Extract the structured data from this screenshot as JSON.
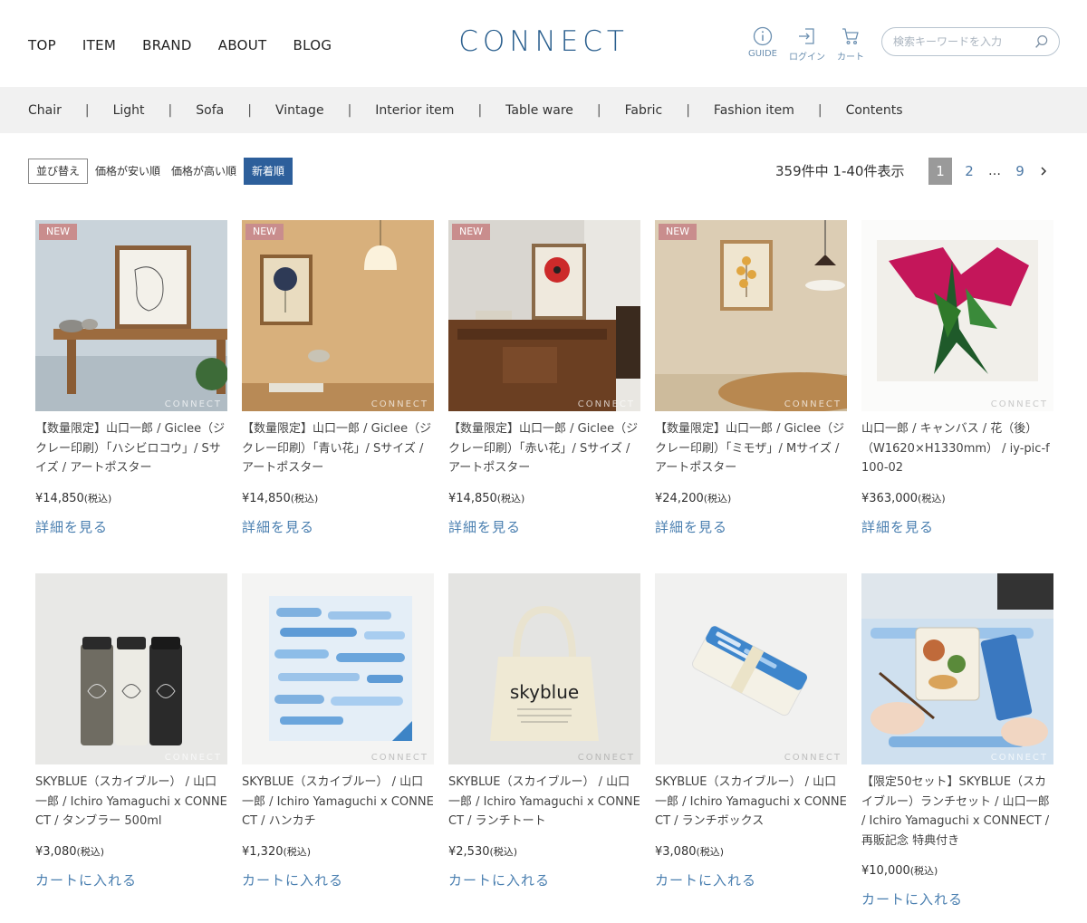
{
  "nav": [
    "TOP",
    "ITEM",
    "BRAND",
    "ABOUT",
    "BLOG"
  ],
  "logo": "CONNECT",
  "util": {
    "guide": "GUIDE",
    "login": "ログイン",
    "cart": "カート"
  },
  "search": {
    "placeholder": "検索キーワードを入力"
  },
  "categories": [
    "Chair",
    "Light",
    "Sofa",
    "Vintage",
    "Interior item",
    "Table ware",
    "Fabric",
    "Fashion item",
    "Contents"
  ],
  "sort": {
    "label": "並び替え",
    "options": [
      "価格が安い順",
      "価格が高い順",
      "新着順"
    ],
    "active": "新着順"
  },
  "result_count": "359件中 1-40件表示",
  "pager": {
    "current": "1",
    "pages": [
      "2"
    ],
    "dots": "…",
    "last": "9"
  },
  "watermark": "CONNECT",
  "badge_new": "NEW",
  "tax_label": "(税込)",
  "colors": {
    "accent": "#2d5f9b",
    "link": "#4a7fb0",
    "badge": "#c98d8d",
    "logo": "#2a5f8e"
  },
  "products": [
    {
      "name": "【数量限定】山口一郎 / Giclee（ジクレー印刷）「ハシビロコウ」/ Sサイズ / アートポスター",
      "price": "¥14,850",
      "cta": "詳細を見る",
      "new": true
    },
    {
      "name": "【数量限定】山口一郎 / Giclee（ジクレー印刷）「青い花」/ Sサイズ / アートポスター",
      "price": "¥14,850",
      "cta": "詳細を見る",
      "new": true
    },
    {
      "name": "【数量限定】山口一郎 / Giclee（ジクレー印刷）「赤い花」/ Sサイズ / アートポスター",
      "price": "¥14,850",
      "cta": "詳細を見る",
      "new": true
    },
    {
      "name": "【数量限定】山口一郎 / Giclee（ジクレー印刷）「ミモザ」/ Mサイズ / アートポスター",
      "price": "¥24,200",
      "cta": "詳細を見る",
      "new": true
    },
    {
      "name": "山口一郎 / キャンバス / 花（後）（W1620×H1330mm） / iy-pic-f100-02",
      "price": "¥363,000",
      "cta": "詳細を見る",
      "new": false
    },
    {
      "name": "SKYBLUE（スカイブルー） / 山口一郎 / Ichiro Yamaguchi x CONNECT / タンブラー 500ml",
      "price": "¥3,080",
      "cta": "カートに入れる",
      "new": false
    },
    {
      "name": "SKYBLUE（スカイブルー） / 山口一郎 / Ichiro Yamaguchi x CONNECT / ハンカチ",
      "price": "¥1,320",
      "cta": "カートに入れる",
      "new": false
    },
    {
      "name": "SKYBLUE（スカイブルー） / 山口一郎 / Ichiro Yamaguchi x CONNECT / ランチトート",
      "price": "¥2,530",
      "cta": "カートに入れる",
      "new": false
    },
    {
      "name": "SKYBLUE（スカイブルー） / 山口一郎 / Ichiro Yamaguchi x CONNECT / ランチボックス",
      "price": "¥3,080",
      "cta": "カートに入れる",
      "new": false
    },
    {
      "name": "【限定50セット】SKYBLUE（スカイブルー）ランチセット / 山口一郎 / Ichiro Yamaguchi x CONNECT / 再販記念 特典付き",
      "price": "¥10,000",
      "cta": "カートに入れる",
      "new": false
    }
  ],
  "tote_text": "skyblue"
}
